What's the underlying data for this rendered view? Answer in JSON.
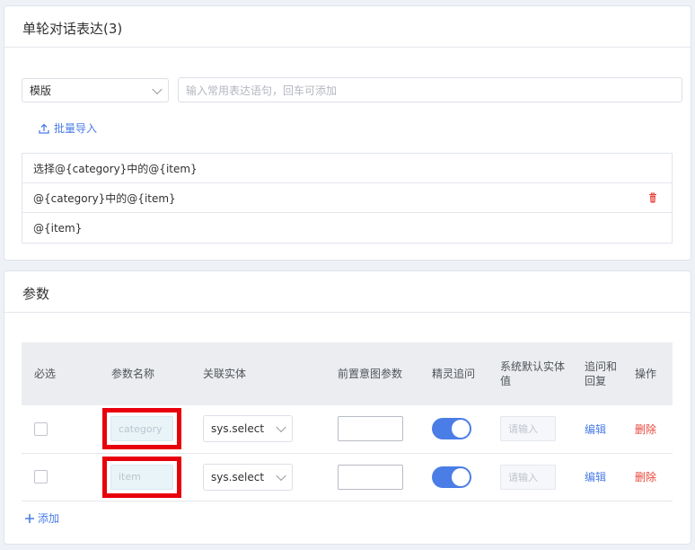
{
  "expressions": {
    "title": "单轮对话表达(3)",
    "template_select": "模版",
    "input_placeholder": "输入常用表达语句，回车可添加",
    "batch_import": "批量导入",
    "items": [
      "选择@{category}中的@{item}",
      "@{category}中的@{item}",
      "@{item}"
    ]
  },
  "params": {
    "title": "参数",
    "headers": [
      "必选",
      "参数名称",
      "关联实体",
      "前置意图参数",
      "精灵追问",
      "系统默认实体值",
      "追问和回复",
      "操作"
    ],
    "rows": [
      {
        "name_placeholder": "category",
        "entity": "sys.select",
        "default_placeholder": "请输入",
        "edit": "编辑",
        "delete": "删除"
      },
      {
        "name_placeholder": "item",
        "entity": "sys.select",
        "default_placeholder": "请输入",
        "edit": "编辑",
        "delete": "删除"
      }
    ],
    "add": "添加"
  },
  "colors": {
    "accent": "#4a7de6",
    "danger": "#e8463c",
    "highlight": "#e8000b"
  }
}
